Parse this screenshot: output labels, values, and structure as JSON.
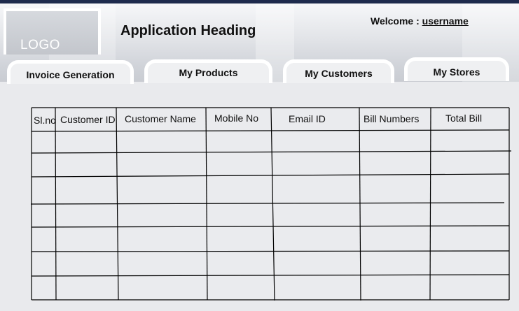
{
  "header": {
    "logo_text": "LOGO",
    "app_heading": "Application Heading",
    "welcome_label": "Welcome :",
    "username": "username"
  },
  "tabs": [
    {
      "label": "Invoice Generation"
    },
    {
      "label": "My Products"
    },
    {
      "label": "My Customers"
    },
    {
      "label": "My Stores"
    }
  ],
  "table": {
    "columns": [
      "Sl.no",
      "Customer ID",
      "Customer Name",
      "Mobile No",
      "Email ID",
      "Bill Numbers",
      "Total Bill"
    ],
    "rows": [
      [
        "",
        "",
        "",
        "",
        "",
        "",
        ""
      ],
      [
        "",
        "",
        "",
        "",
        "",
        "",
        ""
      ],
      [
        "",
        "",
        "",
        "",
        "",
        "",
        ""
      ],
      [
        "",
        "",
        "",
        "",
        "",
        "",
        ""
      ],
      [
        "",
        "",
        "",
        "",
        "",
        "",
        ""
      ],
      [
        "",
        "",
        "",
        "",
        "",
        "",
        ""
      ],
      [
        "",
        "",
        "",
        "",
        "",
        "",
        ""
      ]
    ]
  },
  "colors": {
    "top_bar": "#1e2b4d",
    "background": "#e9eaed",
    "text": "#111111"
  }
}
